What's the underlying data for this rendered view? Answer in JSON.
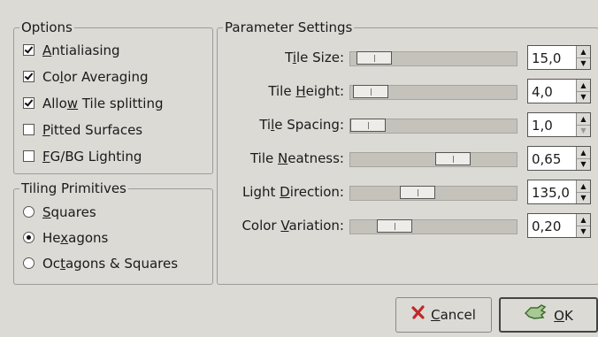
{
  "options": {
    "title": "Options",
    "items": [
      {
        "pre": "",
        "u": "A",
        "post": "ntialiasing",
        "checked": true
      },
      {
        "pre": "Co",
        "u": "l",
        "post": "or Averaging",
        "checked": true
      },
      {
        "pre": "Allo",
        "u": "w",
        "post": " Tile splitting",
        "checked": true
      },
      {
        "pre": "",
        "u": "P",
        "post": "itted Surfaces",
        "checked": false
      },
      {
        "pre": "",
        "u": "F",
        "post": "G/BG Lighting",
        "checked": false
      }
    ]
  },
  "tiling": {
    "title": "Tiling Primitives",
    "items": [
      {
        "pre": "",
        "u": "S",
        "post": "quares",
        "selected": false
      },
      {
        "pre": "He",
        "u": "x",
        "post": "agons",
        "selected": true
      },
      {
        "pre": "Oc",
        "u": "t",
        "post": "agons & Squares",
        "selected": false
      }
    ]
  },
  "params": {
    "title": "Parameter Settings",
    "rows": [
      {
        "pre": "T",
        "u": "i",
        "post": "le Size:",
        "value": "15,0",
        "position": 0.05,
        "up_enabled": true,
        "down_enabled": true
      },
      {
        "pre": "Tile ",
        "u": "H",
        "post": "eight:",
        "value": "4,0",
        "position": 0.02,
        "up_enabled": true,
        "down_enabled": true
      },
      {
        "pre": "Ti",
        "u": "l",
        "post": "e Spacing:",
        "value": "1,0",
        "position": 0.0,
        "up_enabled": true,
        "down_enabled": false
      },
      {
        "pre": "Tile ",
        "u": "N",
        "post": "eatness:",
        "value": "0,65",
        "position": 0.65,
        "up_enabled": true,
        "down_enabled": true
      },
      {
        "pre": "Light ",
        "u": "D",
        "post": "irection:",
        "value": "135,0",
        "position": 0.375,
        "up_enabled": true,
        "down_enabled": true
      },
      {
        "pre": "Color ",
        "u": "V",
        "post": "ariation:",
        "value": "0,20",
        "position": 0.2,
        "up_enabled": true,
        "down_enabled": true
      }
    ]
  },
  "buttons": {
    "cancel": {
      "u": "C",
      "post": "ancel",
      "icon": "cancel-x-icon"
    },
    "ok": {
      "u": "O",
      "post": "K",
      "icon": "ok-hand-icon"
    }
  },
  "spin_glyphs": {
    "up": "▲",
    "down": "▼"
  },
  "colors": {
    "cancel_icon": "#c0282a",
    "ok_icon": "#3b6e2a"
  }
}
